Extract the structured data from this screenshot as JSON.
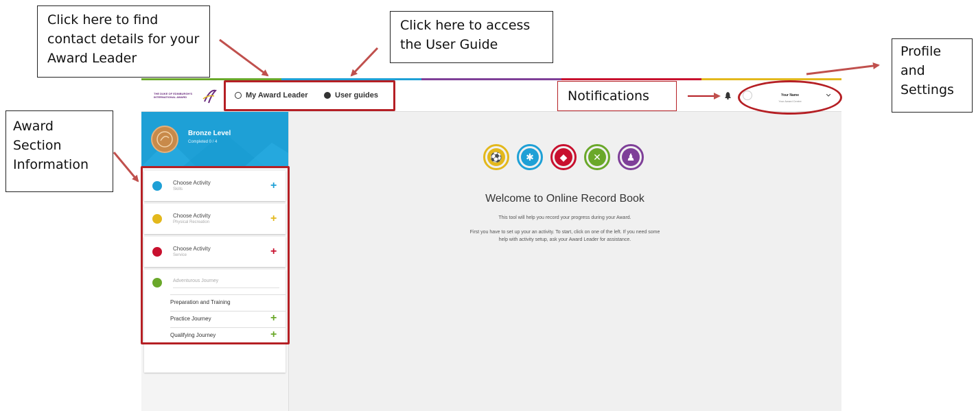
{
  "callouts": {
    "award_leader": "Click here to find contact details for your Award Leader",
    "user_guide": "Click here to access the User Guide",
    "notifications": "Notifications",
    "profile": "Profile and Settings",
    "award_section": "Award Section Information"
  },
  "topbar": {
    "logo_text": "THE DUKE OF EDINBURGH'S INTERNATIONAL AWARD",
    "award_leader_label": "My Award Leader",
    "user_guides_label": "User guides",
    "user_name": "Your Name",
    "user_centre": "Your Award Centre"
  },
  "sidebar": {
    "level_title": "Bronze Level",
    "level_progress": "Completed 0 / 4",
    "cards": [
      {
        "label": "Choose Activity",
        "sub": "Skills",
        "color": "#1ea0d6"
      },
      {
        "label": "Choose Activity",
        "sub": "Physical Recreation",
        "color": "#e3b81c"
      },
      {
        "label": "Choose Activity",
        "sub": "Service",
        "color": "#c8102e"
      }
    ],
    "journey": {
      "label": "Adventurous Journey",
      "color": "#6aa82a",
      "items": [
        "Preparation and Training",
        "Practice Journey",
        "Qualifying Journey"
      ]
    }
  },
  "main": {
    "welcome_title": "Welcome to Online Record Book",
    "line1": "This tool will help you record your progress during your Award.",
    "line2": "First you have to set up your an activity. To start, click on one of the left. If you need some",
    "line3": "help with activity setup, ask your Award Leader for assistance.",
    "icons": [
      {
        "name": "physical-recreation-icon",
        "color": "#e3b81c",
        "glyph": "⚽"
      },
      {
        "name": "skills-icon",
        "color": "#1ea0d6",
        "glyph": "✱"
      },
      {
        "name": "service-icon",
        "color": "#c8102e",
        "glyph": "◆"
      },
      {
        "name": "adventurous-journey-icon",
        "color": "#6aa82a",
        "glyph": "✕"
      },
      {
        "name": "residential-icon",
        "color": "#7e3f98",
        "glyph": "♟"
      }
    ]
  },
  "colors": {
    "skills": "#1ea0d6",
    "physical": "#e3b81c",
    "service": "#c8102e",
    "journey": "#6aa82a",
    "residential": "#7e3f98",
    "callout_red": "#b51f24",
    "arrow_red": "#c0504d"
  }
}
